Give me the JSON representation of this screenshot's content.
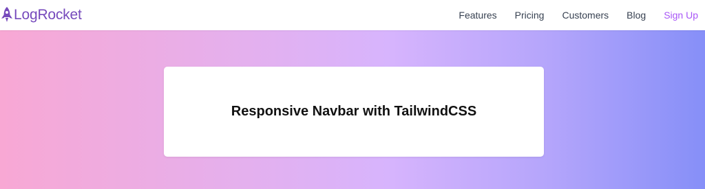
{
  "navbar": {
    "brand": {
      "text": "LogRocket",
      "icon": "rocket-icon",
      "color": "#764abc"
    },
    "links": [
      {
        "label": "Features"
      },
      {
        "label": "Pricing"
      },
      {
        "label": "Customers"
      },
      {
        "label": "Blog"
      }
    ],
    "signup_label": "Sign Up",
    "signup_color": "#a855f7"
  },
  "hero": {
    "gradient_colors": [
      "#f8a8d4",
      "#d7b4fd",
      "#868ff8"
    ],
    "card": {
      "title": "Responsive Navbar with TailwindCSS"
    }
  }
}
